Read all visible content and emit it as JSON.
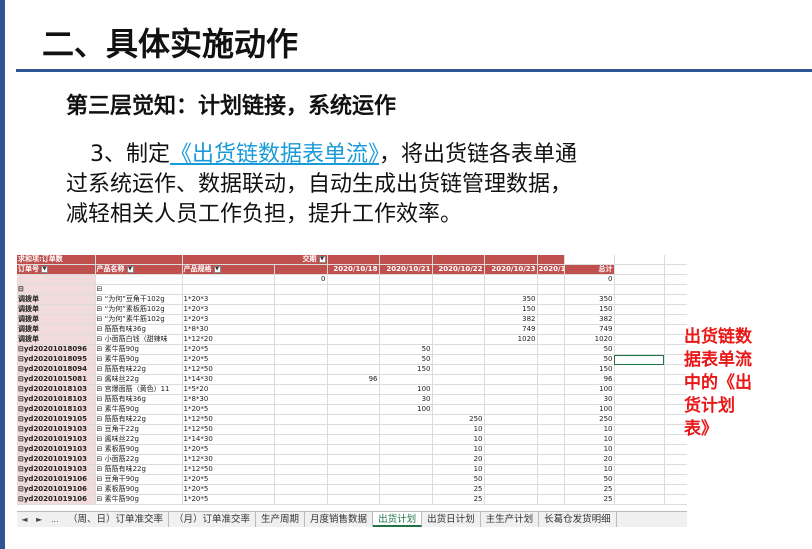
{
  "slide": {
    "title": "二、具体实施动作",
    "subtitle": "第三层觉知：计划链接，系统运作",
    "para_prefix": "3、制定",
    "para_link": "《出货链数据表单流》",
    "para_rest1": "，将出货链各表单通",
    "para_line2": "过系统运作、数据联动，自动生成出货链管理数据，",
    "para_line3": "减轻相关人员工作负担，提升工作效率。",
    "note": "出货链数据表单流中的《出货计划表》"
  },
  "pivot": {
    "corner_label": "求和项:订单数",
    "col_field_label": "交期",
    "row_field_order": "订单号",
    "row_field_product": "产品名称",
    "row_field_spec": "产品规格",
    "date_headers": [
      "2020/10/18",
      "2020/10/21",
      "2020/10/22",
      "2020/10/23",
      "2020/10/24"
    ],
    "total_header": "总计",
    "rows": [
      {
        "order": "",
        "product": "",
        "spec": "",
        "vals": [
          "0",
          "",
          "",
          "",
          "",
          "0"
        ]
      },
      {
        "order": "",
        "product": "",
        "spec": "",
        "vals": [
          "",
          "",
          "",
          "",
          "",
          ""
        ]
      },
      {
        "order": "调拨单",
        "product": "“为何”豆角干102g",
        "spec": "1*20*3",
        "vals": [
          "",
          "",
          "",
          "350",
          "",
          "350"
        ]
      },
      {
        "order": "调拨单",
        "product": "“为何”素板筋102g",
        "spec": "1*20*3",
        "vals": [
          "",
          "",
          "",
          "150",
          "",
          "150"
        ]
      },
      {
        "order": "调拨单",
        "product": "“为何”素牛筋102g",
        "spec": "1*20*3",
        "vals": [
          "",
          "",
          "",
          "382",
          "",
          "382"
        ]
      },
      {
        "order": "调拨单",
        "product": "筋筋有味36g",
        "spec": "1*8*30",
        "vals": [
          "",
          "",
          "",
          "749",
          "",
          "749"
        ]
      },
      {
        "order": "调拨单",
        "product": "小面筋白钱（甜辣味",
        "spec": "1*12*20",
        "vals": [
          "",
          "",
          "",
          "1020",
          "",
          "1020"
        ]
      },
      {
        "order": "yd20201018096",
        "product": "素牛筋90g",
        "spec": "1*20*5",
        "vals": [
          "",
          "50",
          "",
          "",
          "",
          "50"
        ]
      },
      {
        "order": "yd20201018095",
        "product": "素牛筋90g",
        "spec": "1*20*5",
        "vals": [
          "",
          "50",
          "",
          "",
          "",
          "50"
        ]
      },
      {
        "order": "yd20201018094",
        "product": "筋筋有味22g",
        "spec": "1*12*50",
        "vals": [
          "",
          "150",
          "",
          "",
          "",
          "150"
        ]
      },
      {
        "order": "yd20201015081",
        "product": "酱味丝22g",
        "spec": "1*14*30",
        "vals": [
          "96",
          "",
          "",
          "",
          "",
          "96"
        ]
      },
      {
        "order": "yd20201018103",
        "product": "宫爆面筋（黄色）11",
        "spec": "1*5*20",
        "vals": [
          "",
          "100",
          "",
          "",
          "",
          "100"
        ]
      },
      {
        "order": "yd20201018103",
        "product": "筋筋有味36g",
        "spec": "1*8*30",
        "vals": [
          "",
          "30",
          "",
          "",
          "",
          "30"
        ]
      },
      {
        "order": "yd20201018103",
        "product": "素牛筋90g",
        "spec": "1*20*5",
        "vals": [
          "",
          "100",
          "",
          "",
          "",
          "100"
        ]
      },
      {
        "order": "yd20201019105",
        "product": "筋筋有味22g",
        "spec": "1*12*50",
        "vals": [
          "",
          "",
          "250",
          "",
          "",
          "250"
        ]
      },
      {
        "order": "yd20201019103",
        "product": "豆角干22g",
        "spec": "1*12*50",
        "vals": [
          "",
          "",
          "10",
          "",
          "",
          "10"
        ]
      },
      {
        "order": "yd20201019103",
        "product": "酱味丝22g",
        "spec": "1*14*30",
        "vals": [
          "",
          "",
          "10",
          "",
          "",
          "10"
        ]
      },
      {
        "order": "yd20201019103",
        "product": "素板筋90g",
        "spec": "1*20*5",
        "vals": [
          "",
          "",
          "10",
          "",
          "",
          "10"
        ]
      },
      {
        "order": "yd20201019103",
        "product": "小面筋22g",
        "spec": "1*12*30",
        "vals": [
          "",
          "",
          "20",
          "",
          "",
          "20"
        ]
      },
      {
        "order": "yd20201019103",
        "product": "筋筋有味22g",
        "spec": "1*12*50",
        "vals": [
          "",
          "",
          "10",
          "",
          "",
          "10"
        ]
      },
      {
        "order": "yd20201019106",
        "product": "豆角干90g",
        "spec": "1*20*5",
        "vals": [
          "",
          "",
          "50",
          "",
          "",
          "50"
        ]
      },
      {
        "order": "yd20201019106",
        "product": "素板筋90g",
        "spec": "1*20*5",
        "vals": [
          "",
          "",
          "25",
          "",
          "",
          "25"
        ]
      },
      {
        "order": "yd20201019106",
        "product": "素牛筋90g",
        "spec": "1*20*5",
        "vals": [
          "",
          "",
          "25",
          "",
          "",
          "25"
        ]
      }
    ]
  },
  "tabs": {
    "nav_prev": "◄",
    "nav_next": "►",
    "nav_more": "...",
    "items": [
      "（周、日）订单准交率",
      "（月）订单准交率",
      "生产周期",
      "月度销售数据",
      "出货计划",
      "出货日计划",
      "主生产计划",
      "长葛仓发货明细"
    ],
    "active": "出货计划"
  }
}
